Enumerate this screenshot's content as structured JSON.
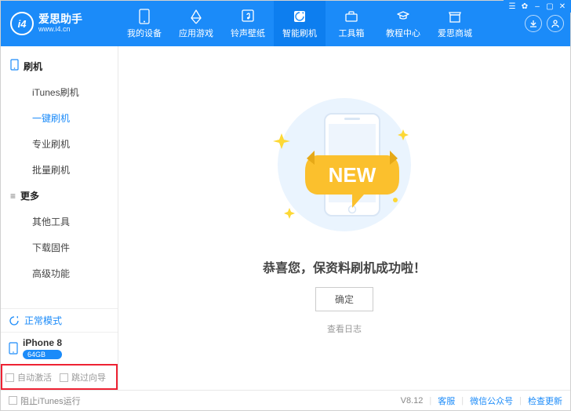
{
  "brand": {
    "logo_text": "i4",
    "name": "爱思助手",
    "sub": "www.i4.cn"
  },
  "nav": {
    "tabs": [
      {
        "label": "我的设备"
      },
      {
        "label": "应用游戏"
      },
      {
        "label": "铃声壁纸"
      },
      {
        "label": "智能刷机"
      },
      {
        "label": "工具箱"
      },
      {
        "label": "教程中心"
      },
      {
        "label": "爱思商城"
      }
    ]
  },
  "sidebar": {
    "group1": {
      "title": "刷机",
      "items": [
        "iTunes刷机",
        "一键刷机",
        "专业刷机",
        "批量刷机"
      ]
    },
    "group2": {
      "title": "更多",
      "items": [
        "其他工具",
        "下载固件",
        "高级功能"
      ]
    },
    "status": "正常模式",
    "device": {
      "name": "iPhone 8",
      "storage": "64GB"
    },
    "auto_activate": "自动激活",
    "skip_guide": "跳过向导"
  },
  "main": {
    "ribbon_text": "NEW",
    "message": "恭喜您，保资料刷机成功啦！",
    "ok": "确定",
    "view_log": "查看日志"
  },
  "footer": {
    "block_itunes": "阻止iTunes运行",
    "version": "V8.12",
    "service": "客服",
    "wechat": "微信公众号",
    "update": "检查更新"
  },
  "winctrl": {
    "lock": "☰",
    "skin": "✿",
    "min": "‒",
    "max": "▢",
    "close": "✕"
  }
}
